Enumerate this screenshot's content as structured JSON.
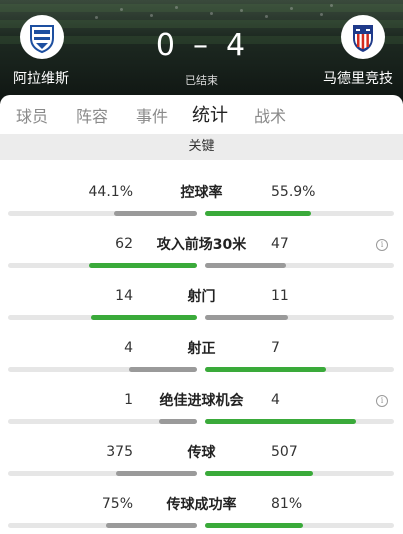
{
  "match": {
    "home_team": "阿拉维斯",
    "away_team": "马德里竞技",
    "home_score": "0",
    "separator": "–",
    "away_score": "4",
    "status": "已结束",
    "home_logo_icon": "alaves-crest-icon",
    "away_logo_icon": "atletico-madrid-crest-icon"
  },
  "tabs": [
    {
      "label": "球员",
      "active": false
    },
    {
      "label": "阵容",
      "active": false
    },
    {
      "label": "事件",
      "active": false
    },
    {
      "label": "统计",
      "active": true
    },
    {
      "label": "战术",
      "active": false
    }
  ],
  "section": {
    "title": "关键"
  },
  "colors": {
    "winner_bar": "#3aaa3a",
    "loser_bar": "#9a9a9a",
    "track": "#e6e6e6"
  },
  "stats": [
    {
      "label": "控球率",
      "home": "44.1%",
      "away": "55.9%",
      "home_share": 0.441,
      "away_share": 0.559,
      "info": false,
      "winner": "away"
    },
    {
      "label": "攻入前场30米",
      "home": "62",
      "away": "47",
      "home_share": 0.57,
      "away_share": 0.43,
      "info": true,
      "winner": "home"
    },
    {
      "label": "射门",
      "home": "14",
      "away": "11",
      "home_share": 0.56,
      "away_share": 0.44,
      "info": false,
      "winner": "home"
    },
    {
      "label": "射正",
      "home": "4",
      "away": "7",
      "home_share": 0.36,
      "away_share": 0.64,
      "info": false,
      "winner": "away"
    },
    {
      "label": "绝佳进球机会",
      "home": "1",
      "away": "4",
      "home_share": 0.2,
      "away_share": 0.8,
      "info": true,
      "winner": "away"
    },
    {
      "label": "传球",
      "home": "375",
      "away": "507",
      "home_share": 0.43,
      "away_share": 0.57,
      "info": false,
      "winner": "away"
    },
    {
      "label": "传球成功率",
      "home": "75%",
      "away": "81%",
      "home_share": 0.48,
      "away_share": 0.52,
      "info": false,
      "winner": "away"
    }
  ]
}
